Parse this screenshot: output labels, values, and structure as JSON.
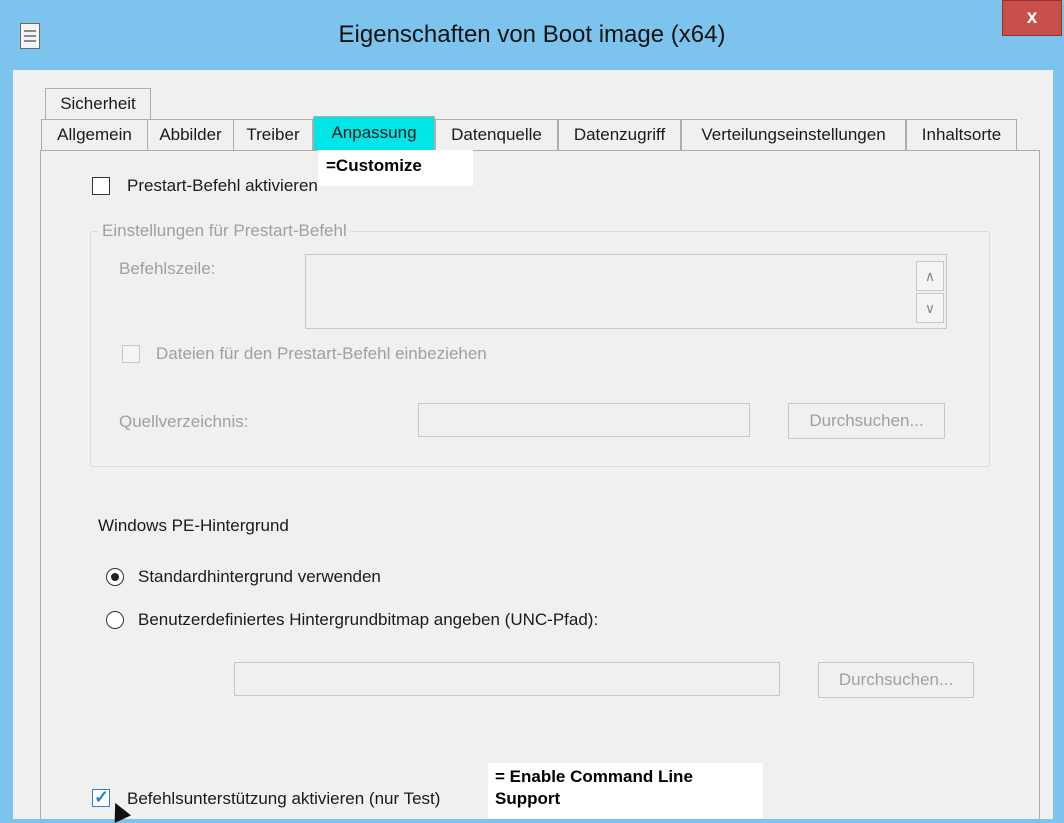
{
  "window": {
    "title": "Eigenschaften von Boot image (x64)",
    "close_label": "x"
  },
  "tabs_row1": [
    "Sicherheit"
  ],
  "tabs_row2": [
    "Allgemein",
    "Abbilder",
    "Treiber",
    "Anpassung",
    "Datenquelle",
    "Datenzugriff",
    "Verteilungseinstellungen",
    "Inhaltsorte"
  ],
  "selected_tab": "Anpassung",
  "annotations": {
    "customize": "=Customize",
    "command_line_line1": "= Enable Command Line",
    "command_line_line2": "Support"
  },
  "prestart": {
    "enable_label": "Prestart-Befehl aktivieren",
    "enabled": false,
    "group_title": "Einstellungen für Prestart-Befehl",
    "command_line_label": "Befehlszeile:",
    "command_line_value": "",
    "include_files_label": "Dateien für den Prestart-Befehl einbeziehen",
    "source_dir_label": "Quellverzeichnis:",
    "source_dir_value": "",
    "browse_label": "Durchsuchen..."
  },
  "background": {
    "section_title": "Windows PE-Hintergrund",
    "default_label": "Standardhintergrund verwenden",
    "custom_label": "Benutzerdefiniertes Hintergrundbitmap angeben (UNC-Pfad):",
    "selected": "default",
    "path_value": "",
    "browse_label": "Durchsuchen..."
  },
  "command_support": {
    "label": "Befehlsunterstützung aktivieren (nur Test)",
    "checked": true
  },
  "colors": {
    "titlebar": "#7cc4ee",
    "selected_tab": "#00e6e6",
    "close_button": "#c7504a"
  }
}
